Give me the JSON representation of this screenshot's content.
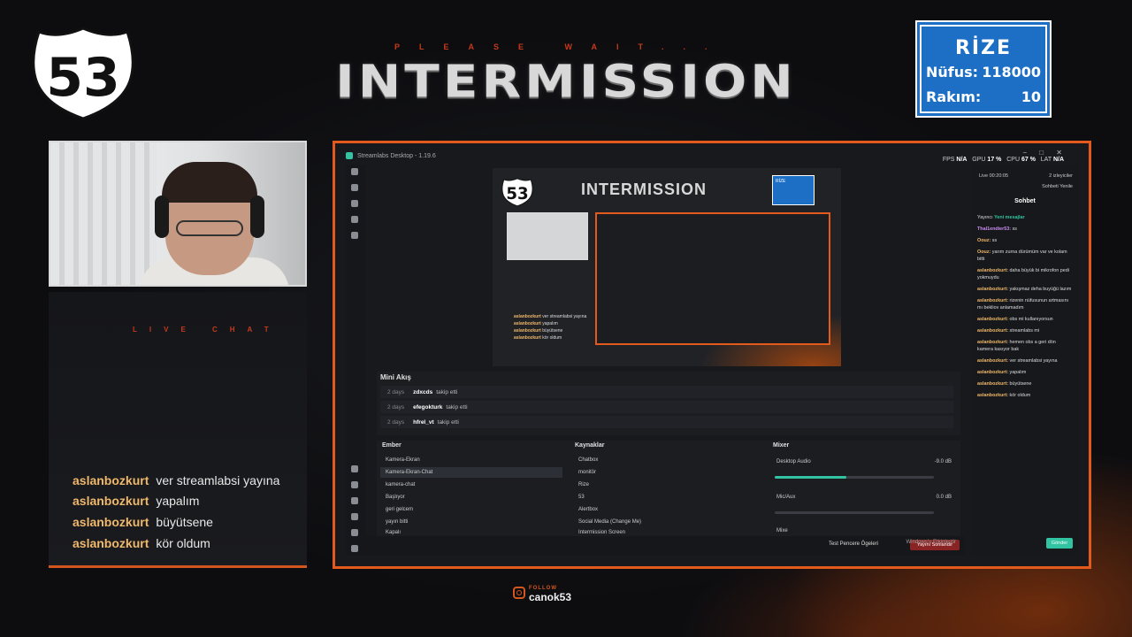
{
  "overlay": {
    "shield_number": "53",
    "subtitle": "PLEASE WAIT...",
    "title": "INTERMISSION",
    "live_chat_label": "LIVE CHAT",
    "city_sign": {
      "name": "RİZE",
      "pop_label": "Nüfus:",
      "pop_value": "118000",
      "alt_label": "Rakım:",
      "alt_value": "10"
    },
    "follow": {
      "label": "FOLLOW",
      "handle": "canok53"
    },
    "accent_color": "#e25a1c"
  },
  "chat": [
    {
      "user": "aslanbozkurt",
      "text": "ver streamlabsi yayına"
    },
    {
      "user": "aslanbozkurt",
      "text": "yapalım"
    },
    {
      "user": "aslanbozkurt",
      "text": "büyütsene"
    },
    {
      "user": "aslanbozkurt",
      "text": "kör oldum"
    }
  ],
  "app": {
    "window_title": "Streamlabs Desktop - 1.19.6",
    "stats": {
      "fps_label": "FPS",
      "fps": "N/A",
      "gpu_label": "GPU",
      "gpu": "17 %",
      "cpu_label": "CPU",
      "cpu": "67 %",
      "lat_label": "LAT",
      "lat": "N/A"
    },
    "mini_feed": {
      "title": "Mini Akış",
      "rows": [
        {
          "age": "2 days",
          "name": "zdxcds",
          "action": "takip etti"
        },
        {
          "age": "2 days",
          "name": "efegokturk",
          "action": "takip etti"
        },
        {
          "age": "2 days",
          "name": "hfrel_vt",
          "action": "takip etti"
        }
      ]
    },
    "scenes": {
      "title": "Ember",
      "items": [
        "Kamera-Ekran",
        "Kamera-Ekran-Chat",
        "kamera-chat",
        "Başlıyor",
        "geri gelcem",
        "yayın bitti",
        "Kapalı"
      ]
    },
    "sources": {
      "title": "Kaynaklar",
      "items": [
        "Chatbox",
        "monitör",
        "Rize",
        "53",
        "Alertbox",
        "Social Media (Change Me)",
        "Intermission Screen"
      ]
    },
    "mixer": {
      "title": "Mixer",
      "channels": [
        {
          "name": "Desktop Audio",
          "db": "-9.0 dB",
          "level": 0.45
        },
        {
          "name": "Mic/Aux",
          "db": "0.0 dB",
          "level": 0.0
        }
      ],
      "cut_label": "Mixe"
    },
    "footer": {
      "test_label": "Test Pencere Ögeleri",
      "end_button": "Yayını Sonlandır"
    },
    "chat_panel": {
      "live_time": "Live 00:20:05",
      "viewers": "2 izleyiciler",
      "refresh": "Sohbeti Yenile",
      "title": "Sohbet",
      "badge": "Yayıncı",
      "new_messages": "Yeni mesajlar",
      "messages": [
        {
          "user": "Thal1endier53:",
          "text": "ss"
        },
        {
          "user": "Oouz:",
          "text": "ss"
        },
        {
          "user": "Oouz:",
          "text": "yarım zurna dürümüm var ve kolam bitti"
        },
        {
          "user": "aslanbozkurt:",
          "text": "daha büyük bi mikrofon pedi yokmuydu"
        },
        {
          "user": "aslanbozkurt:",
          "text": "yakışmaz deha buyüğü lazım"
        },
        {
          "user": "aslanbozkurt:",
          "text": "rizenin nüfusunun artmasını mı bekliov anlamadım"
        },
        {
          "user": "aslanbozkurt:",
          "text": "obs mi kullanıyorsun"
        },
        {
          "user": "aslanbozkurt:",
          "text": "streamlabs mi"
        },
        {
          "user": "aslanbozkurt:",
          "text": "hemen obs a geri dön kamera kasıyor bak"
        },
        {
          "user": "aslanbozkurt:",
          "text": "ver streamlabsi yayına"
        },
        {
          "user": "aslanbozkurt:",
          "text": "yapalım"
        },
        {
          "user": "aslanbozkurt:",
          "text": "büyütsene"
        },
        {
          "user": "aslanbozkurt:",
          "text": "kör oldum"
        }
      ],
      "send_button": "Gönder"
    },
    "windows_watermark": "Windows'u Etkinleştir"
  }
}
